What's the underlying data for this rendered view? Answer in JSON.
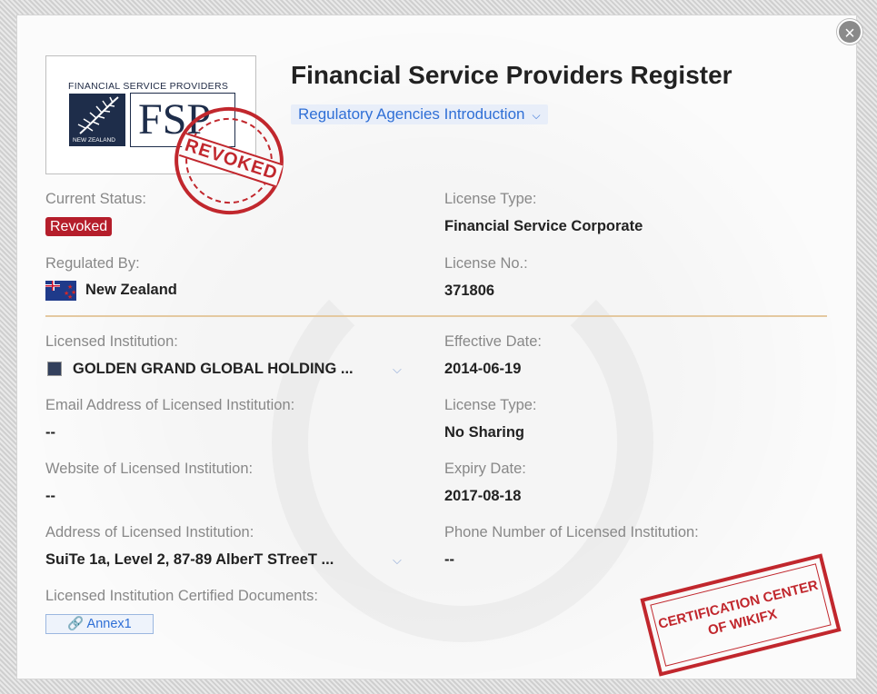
{
  "close_label": "×",
  "logo": {
    "caption": "FINANCIAL SERVICE PROVIDERS",
    "fern_text": "NEW ZEALAND",
    "mark_text": "FSP"
  },
  "stamp_revoked": "REVOKED",
  "title": "Financial Service Providers Register",
  "regulatory_link": "Regulatory Agencies Introduction",
  "fields": {
    "current_status_label": "Current Status:",
    "current_status_value": "Revoked",
    "license_type_label": "License Type:",
    "license_type_value": "Financial Service Corporate",
    "regulated_by_label": "Regulated By:",
    "regulated_by_value": "New Zealand",
    "license_no_label": "License No.:",
    "license_no_value": "371806",
    "licensed_institution_label": "Licensed Institution:",
    "licensed_institution_value": "GOLDEN GRAND GLOBAL HOLDING ...",
    "effective_date_label": "Effective Date:",
    "effective_date_value": "2014-06-19",
    "email_label": "Email Address of Licensed Institution:",
    "email_value": "--",
    "license_type2_label": "License Type:",
    "license_type2_value": "No Sharing",
    "website_label": "Website of Licensed Institution:",
    "website_value": "--",
    "expiry_label": "Expiry Date:",
    "expiry_value": "2017-08-18",
    "address_label": "Address of Licensed Institution:",
    "address_value": "SuiTe 1a, Level 2, 87-89 AlberT STreeT ...",
    "phone_label": "Phone Number of Licensed Institution:",
    "phone_value": "--",
    "docs_label": "Licensed Institution Certified Documents:",
    "annex_label": "Annex1"
  },
  "stamp_cert": {
    "line1": "CERTIFICATION CENTER",
    "line2": "OF WIKIFX"
  },
  "colors": {
    "revoked_red": "#b51e2b",
    "link_blue": "#2f6fd6",
    "divider": "#e4c9a0"
  }
}
